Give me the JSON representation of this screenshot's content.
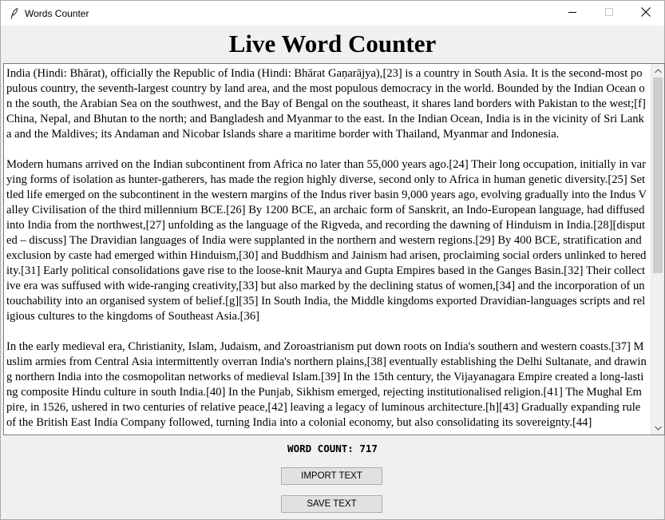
{
  "window": {
    "title": "Words Counter"
  },
  "heading": "Live Word Counter",
  "text_area": {
    "paragraphs": [
      "India (Hindi: Bhārat), officially the Republic of India (Hindi: Bhārat Gaṇarājya),[23] is a country in South Asia. It is the second-most populous country, the seventh-largest country by land area, and the most populous democracy in the world. Bounded by the Indian Ocean on the south, the Arabian Sea on the southwest, and the Bay of Bengal on the southeast, it shares land borders with Pakistan to the west;[f] China, Nepal, and Bhutan to the north; and Bangladesh and Myanmar to the east. In the Indian Ocean, India is in the vicinity of Sri Lanka and the Maldives; its Andaman and Nicobar Islands share a maritime border with Thailand, Myanmar and Indonesia.",
      "Modern humans arrived on the Indian subcontinent from Africa no later than 55,000 years ago.[24] Their long occupation, initially in varying forms of isolation as hunter-gatherers, has made the region highly diverse, second only to Africa in human genetic diversity.[25] Settled life emerged on the subcontinent in the western margins of the Indus river basin 9,000 years ago, evolving gradually into the Indus Valley Civilisation of the third millennium BCE.[26] By 1200 BCE, an archaic form of Sanskrit, an Indo-European language, had diffused into India from the northwest,[27] unfolding as the language of the Rigveda, and recording the dawning of Hinduism in India.[28][disputed – discuss] The Dravidian languages of India were supplanted in the northern and western regions.[29] By 400 BCE, stratification and exclusion by caste had emerged within Hinduism,[30] and Buddhism and Jainism had arisen, proclaiming social orders unlinked to heredity.[31] Early political consolidations gave rise to the loose-knit Maurya and Gupta Empires based in the Ganges Basin.[32] Their collective era was suffused with wide-ranging creativity,[33] but also marked by the declining status of women,[34] and the incorporation of untouchability into an organised system of belief.[g][35] In South India, the Middle kingdoms exported Dravidian-languages scripts and religious cultures to the kingdoms of Southeast Asia.[36]",
      "In the early medieval era, Christianity, Islam, Judaism, and Zoroastrianism put down roots on India's southern and western coasts.[37] Muslim armies from Central Asia intermittently overran India's northern plains,[38] eventually establishing the Delhi Sultanate, and drawing northern India into the cosmopolitan networks of medieval Islam.[39] In the 15th century, the Vijayanagara Empire created a long-lasting composite Hindu culture in south India.[40] In the Punjab, Sikhism emerged, rejecting institutionalised religion.[41] The Mughal Empire, in 1526, ushered in two centuries of relative peace,[42] leaving a legacy of luminous architecture.[h][43] Gradually expanding rule of the British East India Company followed, turning India into a colonial economy, but also consolidating its sovereignty.[44]"
    ]
  },
  "word_count": "WORD COUNT: 717",
  "buttons": {
    "import": "IMPORT TEXT",
    "save": "SAVE TEXT"
  },
  "icons": {
    "app": "feather-icon",
    "minimize": "minimize-icon",
    "maximize": "maximize-icon",
    "close": "close-icon",
    "scroll_up": "scroll-up-arrow-icon",
    "scroll_down": "scroll-down-arrow-icon"
  }
}
